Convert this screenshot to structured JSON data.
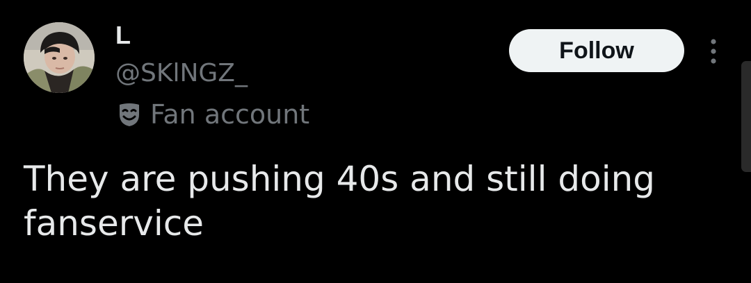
{
  "author": {
    "display_name": "L",
    "handle": "@SKlNGZ_",
    "avatar_icon": "profile-photo",
    "label_icon": "theater-mask-icon",
    "label_text": "Fan account"
  },
  "actions": {
    "follow_label": "Follow",
    "more_icon": "more-vertical-icon"
  },
  "tweet": {
    "text": "They are pushing 40s and still doing fanservice"
  },
  "colors": {
    "background": "#000000",
    "primary_text": "#e7e9ea",
    "secondary_text": "#71767b",
    "follow_bg": "#eff3f4",
    "follow_text": "#0f1419"
  }
}
